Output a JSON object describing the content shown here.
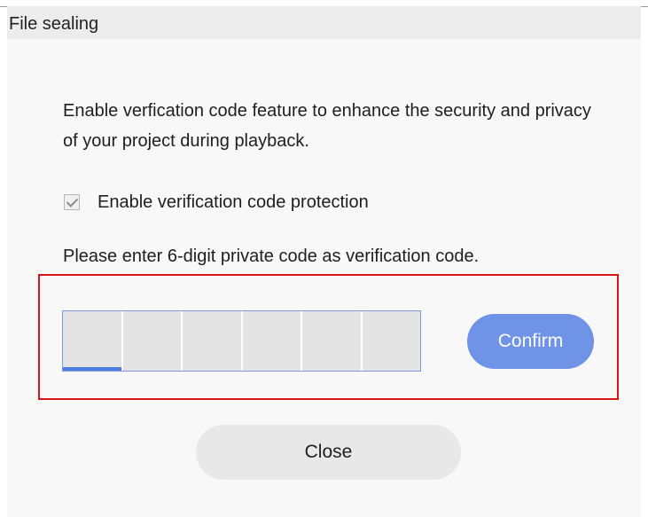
{
  "dialog": {
    "title": "File sealing",
    "description": "Enable verfication code feature to enhance the security and privacy of your project during playback.",
    "checkbox": {
      "label": "Enable verification code protection",
      "checked": true,
      "disabled": true
    },
    "instruction": "Please enter 6-digit private code as verification code.",
    "code_inputs": [
      "",
      "",
      "",
      "",
      "",
      ""
    ],
    "active_input_index": 0,
    "confirm_label": "Confirm",
    "close_label": "Close"
  },
  "colors": {
    "accent": "#6f93e6",
    "highlight_border": "#d91515",
    "active_underline": "#4e7fe0"
  }
}
